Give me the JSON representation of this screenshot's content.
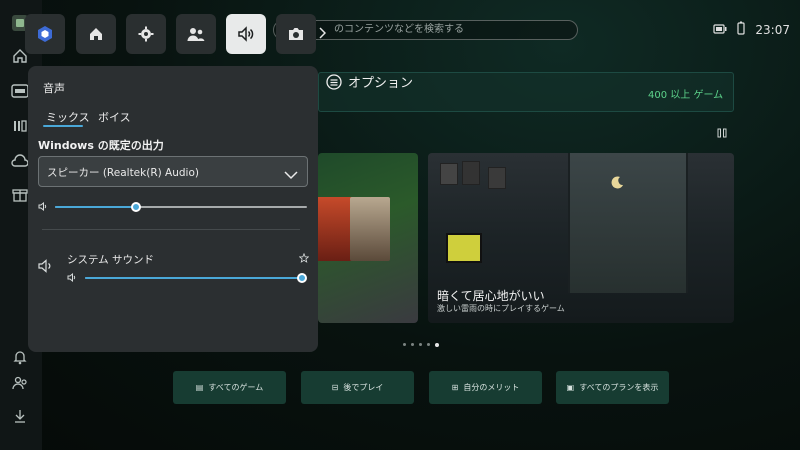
{
  "header": {
    "search_placeholder": "のコンテンツなどを検索する",
    "time": "23:07"
  },
  "quickbar": {
    "items": [
      {
        "icon": "widget-icon"
      },
      {
        "icon": "home-icon"
      },
      {
        "icon": "gear-icon"
      },
      {
        "icon": "people-icon"
      },
      {
        "icon": "volume-icon",
        "active": true
      },
      {
        "icon": "camera-icon"
      }
    ]
  },
  "banner": {
    "options_label": "オプション",
    "games_count": "400 以上 ゲーム"
  },
  "cards": {
    "featured_title": "暗くて居心地がいい",
    "featured_subtitle": "激しい雷雨の時にプレイするゲーム"
  },
  "bottom_buttons": [
    "すべてのゲーム",
    "後でプレイ",
    "自分のメリット",
    "すべてのプランを表示"
  ],
  "sound_panel": {
    "title": "音声",
    "tabs": [
      "ミックス",
      "ボイス"
    ],
    "active_tab": 0,
    "output_title": "Windows の既定の出力",
    "output_device": "スピーカー (Realtek(R) Audio)",
    "master_volume_fraction": 0.32,
    "system_sound_label": "システム サウンド",
    "system_volume_fraction": 1.0
  },
  "colors": {
    "accent": "#4aa8d8",
    "panel": "#2b2f31",
    "green_text": "#5dd38b"
  }
}
